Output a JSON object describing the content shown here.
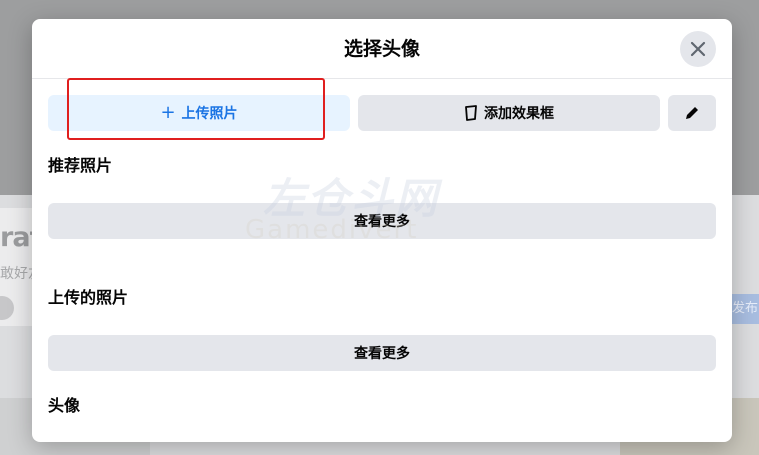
{
  "background": {
    "partial_title": "raf",
    "partial_subtitle": "敢好友",
    "partial_publish": "发布"
  },
  "modal": {
    "title": "选择头像",
    "close_icon": "close-icon",
    "actions": {
      "upload_label": "上传照片",
      "frame_label": "添加效果框",
      "edit_icon": "pencil-icon"
    },
    "sections": [
      {
        "title": "推荐照片",
        "more_label": "查看更多"
      },
      {
        "title": "上传的照片",
        "more_label": "查看更多"
      },
      {
        "title": "头像"
      }
    ]
  },
  "watermark": {
    "cn": "左仓斗网",
    "en": "Gamedivert"
  },
  "annotation": {
    "color": "#e01f1f"
  },
  "colors": {
    "accent": "#1b74e4",
    "accent_bg": "#e7f3ff",
    "button_bg": "#e4e6eb"
  }
}
